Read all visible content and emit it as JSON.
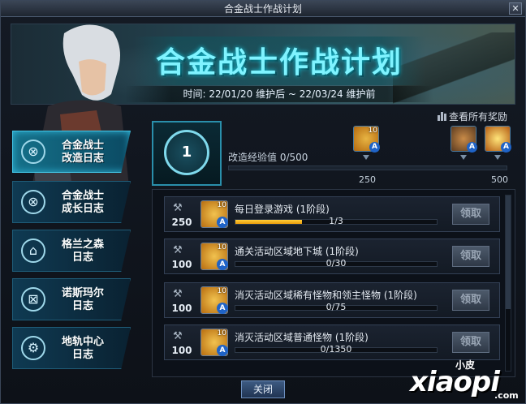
{
  "window": {
    "title": "合金战士作战计划",
    "close_glyph": "✕"
  },
  "banner": {
    "title": "合金战士作战计划",
    "time": "时间: 22/01/20 维护后 ~ 22/03/24 维护前"
  },
  "view_all_label": "查看所有奖励",
  "nav": [
    {
      "label_1": "合金战士",
      "label_2": "改造日志",
      "icon": "target-icon",
      "glyph": "⊗",
      "active": true
    },
    {
      "label_1": "合金战士",
      "label_2": "成长日志",
      "icon": "target-icon",
      "glyph": "⊗",
      "active": false
    },
    {
      "label_1": "格兰之森",
      "label_2": "日志",
      "icon": "gate-icon",
      "glyph": "⌂",
      "active": false
    },
    {
      "label_1": "诺斯玛尔",
      "label_2": "日志",
      "icon": "door-icon",
      "glyph": "⊠",
      "active": false
    },
    {
      "label_1": "地轨中心",
      "label_2": "日志",
      "icon": "gear-icon",
      "glyph": "⚙",
      "active": false
    }
  ],
  "stage": {
    "number": "1"
  },
  "experience": {
    "label": "改造经验值",
    "value": "0/500",
    "progress": 0,
    "ticks": [
      "250",
      "500"
    ],
    "milestones": [
      {
        "count": "10",
        "icon": "coin-box-icon"
      },
      {
        "count": "",
        "icon": "potion-icon"
      },
      {
        "count": "",
        "icon": "spark-box-icon"
      }
    ]
  },
  "quests": [
    {
      "points": "250",
      "reward_count": "10",
      "name": "每日登录游戏 (1阶段)",
      "progress_text": "1/3",
      "progress": 0.33,
      "button": "领取"
    },
    {
      "points": "100",
      "reward_count": "10",
      "name": "通关活动区域地下城 (1阶段)",
      "progress_text": "0/30",
      "progress": 0,
      "button": "领取"
    },
    {
      "points": "100",
      "reward_count": "10",
      "name": "消灭活动区域稀有怪物和领主怪物 (1阶段)",
      "progress_text": "0/75",
      "progress": 0,
      "button": "领取"
    },
    {
      "points": "100",
      "reward_count": "10",
      "name": "消灭活动区域普通怪物 (1阶段)",
      "progress_text": "0/1350",
      "progress": 0,
      "button": "领取"
    }
  ],
  "close_button": "关闭",
  "watermark": {
    "sub": "小皮",
    "main": "xiaopi",
    "domain": ".com"
  },
  "colors": {
    "accent": "#7ff3ff",
    "progress": "#f3b21f",
    "nav_active": "#157089"
  }
}
